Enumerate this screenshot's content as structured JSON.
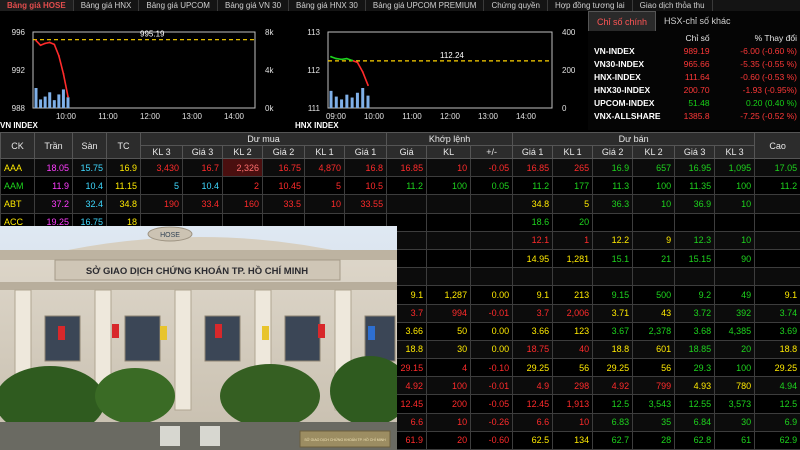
{
  "tabs": [
    "Bảng giá HOSE",
    "Bảng giá HNX",
    "Bảng giá UPCOM",
    "Bảng giá VN 30",
    "Bảng giá HNX 30",
    "Bảng giá UPCOM PREMIUM",
    "Chứng quyền",
    "Hợp đồng tương lai",
    "Giao dịch thỏa thu"
  ],
  "colors": {
    "up": "#1ed41e",
    "down": "#ff2b2b",
    "ref": "#ffea00",
    "ceiling": "#ff3dff",
    "floor": "#3fd9ff",
    "dashed_ref": "#ffd400"
  },
  "chart_data": [
    {
      "type": "line",
      "title": "VN INDEX",
      "ref_label": "995.19",
      "ref_value": 995.19,
      "ylim": [
        988,
        996
      ],
      "y_ticks": [
        996,
        992,
        988
      ],
      "y2_ticks": [
        "8k",
        "4k",
        "0k"
      ],
      "x_ticks": [
        "10:00",
        "11:00",
        "12:00",
        "13:00",
        "14:00"
      ],
      "x": [
        "09:05",
        "09:15",
        "09:25",
        "09:35",
        "09:45",
        "09:55",
        "10:00",
        "10:05"
      ],
      "series": [
        {
          "values": [
            995.1,
            994.6,
            994.8,
            994.9,
            994.7,
            993.5,
            991.6,
            989.2
          ]
        }
      ],
      "volume_k": [
        2.8,
        1.2,
        1.6,
        2.2,
        1.1,
        1.9,
        2.6,
        1.5
      ]
    },
    {
      "type": "line",
      "title": "HNX INDEX",
      "ref_label": "112.24",
      "ref_value": 112.24,
      "ylim": [
        111,
        113
      ],
      "y_ticks": [
        113,
        112,
        111
      ],
      "y2_ticks": [
        "400",
        "200",
        "0"
      ],
      "x_ticks": [
        "09:00",
        "10:00",
        "11:00",
        "12:00",
        "13:00",
        "14:00"
      ],
      "x": [
        "09:05",
        "09:15",
        "09:25",
        "09:35",
        "09:45",
        "09:55",
        "10:00",
        "10:05"
      ],
      "series": [
        {
          "values": [
            112.35,
            112.3,
            112.28,
            112.3,
            112.25,
            112.2,
            111.95,
            111.6
          ]
        }
      ],
      "volume_k": [
        180,
        120,
        90,
        140,
        110,
        160,
        210,
        130
      ]
    }
  ],
  "index_panel": {
    "tabs": [
      "Chỉ số chính",
      "HSX-chỉ số khác"
    ],
    "headers": [
      "Chỉ số",
      "% Thay đổi"
    ],
    "rows": [
      {
        "name": "VN-INDEX",
        "value": "989.19",
        "change": "-6.00 (-0.60 %)"
      },
      {
        "name": "VN30-INDEX",
        "value": "965.66",
        "change": "-5.35 (-0.55 %)"
      },
      {
        "name": "HNX-INDEX",
        "value": "111.64",
        "change": "-0.60 (-0.53 %)"
      },
      {
        "name": "HNX30-INDEX",
        "value": "200.70",
        "change": "-1.93 (-0.95%)"
      },
      {
        "name": "UPCOM-INDEX",
        "value": "51.48",
        "change": "0.20 (0.40 %)"
      },
      {
        "name": "VNX-ALLSHARE",
        "value": "1385.8",
        "change": "-7.25 (-0.52 %)"
      }
    ]
  },
  "board": {
    "group_headers": {
      "buy": "Dư mua",
      "match": "Khớp lệnh",
      "sell": "Dư bán"
    },
    "columns": [
      "CK",
      "Trần",
      "Sàn",
      "TC",
      "KL 3",
      "Giá 3",
      "KL 2",
      "Giá 2",
      "KL 1",
      "Giá 1",
      "Giá",
      "KL",
      "+/-",
      "Giá 1",
      "KL 1",
      "Giá 2",
      "KL 2",
      "Giá 3",
      "KL 3",
      "Cao"
    ],
    "rows": [
      [
        "AAA",
        "18.05",
        "15.75",
        "16.9",
        "3,430",
        "16.7",
        "2,326",
        "16.75",
        "4,870",
        "16.8",
        "16.85",
        "10",
        "-0.05",
        "16.85",
        "265",
        "16.9",
        "657",
        "16.95",
        "1,095",
        "17.05"
      ],
      [
        "AAM",
        "11.9",
        "10.4",
        "11.15",
        "5",
        "10.4",
        "2",
        "10.45",
        "5",
        "10.5",
        "11.2",
        "100",
        "0.05",
        "11.2",
        "177",
        "11.3",
        "100",
        "11.35",
        "100",
        "11.2"
      ],
      [
        "ABT",
        "37.2",
        "32.4",
        "34.8",
        "190",
        "33.4",
        "160",
        "33.5",
        "10",
        "33.55",
        "",
        "",
        "",
        "34.8",
        "5",
        "36.3",
        "10",
        "36.9",
        "10",
        ""
      ],
      [
        "ACC",
        "19.25",
        "16.75",
        "18",
        "",
        "",
        "",
        "",
        "",
        "",
        "",
        "",
        "",
        "18.6",
        "20",
        "",
        "",
        "",
        "",
        ""
      ],
      [
        "",
        "",
        "",
        "",
        "",
        "",
        "",
        "",
        "",
        "",
        "",
        "",
        "",
        "12.1",
        "1",
        "12.2",
        "9",
        "12.3",
        "10",
        ""
      ],
      [
        "",
        "",
        "",
        "",
        "",
        "",
        "",
        "",
        "",
        "",
        "",
        "",
        "",
        "14.95",
        "1,281",
        "15.1",
        "21",
        "15.15",
        "90",
        ""
      ],
      [
        "",
        "",
        "",
        "",
        "",
        "",
        "",
        "",
        "",
        "",
        "",
        "",
        "",
        "",
        "",
        "",
        "",
        "",
        "",
        ""
      ],
      [
        "",
        "",
        "",
        "",
        "",
        "",
        "",
        "",
        "",
        "",
        "9.1",
        "1,287",
        "0.00",
        "9.1",
        "213",
        "9.15",
        "500",
        "9.2",
        "49",
        "9.1"
      ],
      [
        "",
        "",
        "",
        "",
        "",
        "",
        "",
        "",
        "",
        "",
        "3.7",
        "994",
        "-0.01",
        "3.7",
        "2,006",
        "3.71",
        "43",
        "3.72",
        "392",
        "3.74"
      ],
      [
        "",
        "",
        "",
        "",
        "",
        "",
        "",
        "",
        "",
        "",
        "3.66",
        "50",
        "0.00",
        "3.66",
        "123",
        "3.67",
        "2,378",
        "3.68",
        "4,385",
        "3.69"
      ],
      [
        "",
        "",
        "",
        "",
        "",
        "",
        "",
        "",
        "",
        "",
        "18.8",
        "30",
        "0.00",
        "18.75",
        "40",
        "18.8",
        "601",
        "18.85",
        "20",
        "18.8"
      ],
      [
        "",
        "",
        "",
        "",
        "",
        "",
        "",
        "",
        "",
        "",
        "29.15",
        "4",
        "-0.10",
        "29.25",
        "56",
        "29.25",
        "56",
        "29.3",
        "100",
        "29.25"
      ],
      [
        "",
        "",
        "",
        "",
        "",
        "",
        "",
        "",
        "",
        "",
        "4.92",
        "100",
        "-0.01",
        "4.9",
        "298",
        "4.92",
        "799",
        "4.93",
        "780",
        "4.94"
      ],
      [
        "",
        "",
        "",
        "",
        "",
        "",
        "",
        "",
        "",
        "",
        "12.45",
        "200",
        "-0.05",
        "12.45",
        "1,913",
        "12.5",
        "3,543",
        "12.55",
        "3,573",
        "12.5"
      ],
      [
        "",
        "",
        "",
        "",
        "",
        "",
        "",
        "",
        "",
        "",
        "6.6",
        "10",
        "-0.26",
        "6.6",
        "10",
        "6.83",
        "35",
        "6.84",
        "30",
        "6.9"
      ],
      [
        "",
        "",
        "",
        "",
        "",
        "",
        "",
        "",
        "",
        "",
        "61.9",
        "20",
        "-0.60",
        "62.5",
        "134",
        "62.7",
        "28",
        "62.8",
        "61",
        "62.9"
      ]
    ],
    "row_colors": [
      [
        "yellow",
        "purple",
        "cyan",
        "yellow",
        "red",
        "red",
        "red",
        "red",
        "red",
        "red",
        "red",
        "red",
        "red",
        "red",
        "red",
        "green",
        "green",
        "green",
        "green",
        "green"
      ],
      [
        "green",
        "purple",
        "cyan",
        "yellow",
        "cyan",
        "cyan",
        "red",
        "red",
        "red",
        "red",
        "green",
        "green",
        "green",
        "green",
        "green",
        "green",
        "green",
        "green",
        "green",
        "green"
      ],
      [
        "yellow",
        "purple",
        "cyan",
        "yellow",
        "red",
        "red",
        "red",
        "red",
        "red",
        "red",
        "white",
        "white",
        "white",
        "yellow",
        "yellow",
        "green",
        "green",
        "green",
        "green",
        "white"
      ],
      [
        "yellow",
        "purple",
        "cyan",
        "yellow",
        "red",
        "red",
        "red",
        "red",
        "red",
        "red",
        "white",
        "white",
        "white",
        "green",
        "green",
        "white",
        "white",
        "white",
        "white",
        "white"
      ],
      [
        "yellow",
        "purple",
        "cyan",
        "yellow",
        "red",
        "red",
        "red",
        "red",
        "red",
        "red",
        "white",
        "white",
        "white",
        "red",
        "red",
        "yellow",
        "yellow",
        "green",
        "green",
        "white"
      ],
      [
        "yellow",
        "purple",
        "cyan",
        "yellow",
        "red",
        "red",
        "red",
        "red",
        "red",
        "red",
        "white",
        "white",
        "white",
        "yellow",
        "yellow",
        "green",
        "green",
        "green",
        "green",
        "white"
      ],
      [
        "yellow",
        "purple",
        "cyan",
        "yellow",
        "red",
        "red",
        "red",
        "red",
        "red",
        "red",
        "white",
        "white",
        "white",
        "white",
        "white",
        "white",
        "white",
        "white",
        "white",
        "white"
      ],
      [
        "yellow",
        "purple",
        "cyan",
        "yellow",
        "red",
        "red",
        "red",
        "red",
        "red",
        "red",
        "yellow",
        "yellow",
        "yellow",
        "yellow",
        "yellow",
        "green",
        "green",
        "green",
        "green",
        "yellow"
      ],
      [
        "yellow",
        "purple",
        "cyan",
        "yellow",
        "red",
        "red",
        "red",
        "red",
        "red",
        "red",
        "red",
        "red",
        "red",
        "red",
        "red",
        "yellow",
        "yellow",
        "green",
        "green",
        "green"
      ],
      [
        "yellow",
        "purple",
        "cyan",
        "yellow",
        "red",
        "red",
        "red",
        "red",
        "red",
        "red",
        "yellow",
        "yellow",
        "yellow",
        "yellow",
        "yellow",
        "green",
        "green",
        "green",
        "green",
        "green"
      ],
      [
        "yellow",
        "purple",
        "cyan",
        "yellow",
        "red",
        "red",
        "red",
        "red",
        "red",
        "red",
        "yellow",
        "yellow",
        "yellow",
        "red",
        "red",
        "yellow",
        "yellow",
        "green",
        "green",
        "yellow"
      ],
      [
        "yellow",
        "purple",
        "cyan",
        "yellow",
        "red",
        "red",
        "red",
        "red",
        "red",
        "red",
        "red",
        "red",
        "red",
        "yellow",
        "yellow",
        "yellow",
        "yellow",
        "green",
        "green",
        "yellow"
      ],
      [
        "yellow",
        "purple",
        "cyan",
        "yellow",
        "red",
        "red",
        "red",
        "red",
        "red",
        "red",
        "red",
        "red",
        "red",
        "red",
        "red",
        "red",
        "red",
        "yellow",
        "yellow",
        "green"
      ],
      [
        "yellow",
        "purple",
        "cyan",
        "yellow",
        "red",
        "red",
        "red",
        "red",
        "red",
        "red",
        "red",
        "red",
        "red",
        "red",
        "red",
        "green",
        "green",
        "green",
        "green",
        "green"
      ],
      [
        "yellow",
        "purple",
        "cyan",
        "yellow",
        "red",
        "red",
        "red",
        "red",
        "red",
        "red",
        "red",
        "red",
        "red",
        "red",
        "red",
        "green",
        "green",
        "green",
        "green",
        "green"
      ],
      [
        "yellow",
        "purple",
        "cyan",
        "yellow",
        "red",
        "red",
        "red",
        "red",
        "red",
        "red",
        "red",
        "red",
        "red",
        "yellow",
        "yellow",
        "green",
        "green",
        "green",
        "green",
        "green"
      ]
    ]
  },
  "photo": {
    "sign": "SỞ GIAO DỊCH CHỨNG KHOÁN TP. HỒ CHÍ MINH",
    "logo": "HOSE",
    "plaque": "SỞ GIAO DỊCH CHỨNG KHOÁN TP. HỒ CHÍ MINH"
  }
}
